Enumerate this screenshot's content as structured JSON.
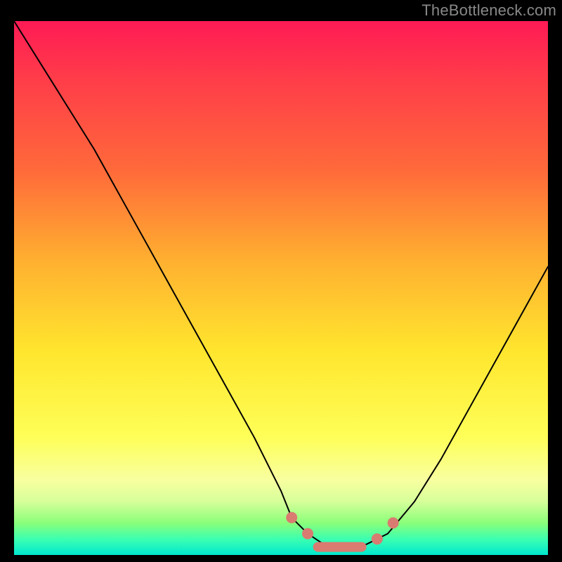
{
  "watermark": "TheBottleneck.com",
  "colors": {
    "background": "#000000",
    "curve": "#000000",
    "marker": "#d97b70"
  },
  "chart_data": {
    "type": "line",
    "title": "",
    "xlabel": "",
    "ylabel": "",
    "xlim": [
      0,
      100
    ],
    "ylim": [
      0,
      100
    ],
    "grid": false,
    "legend": false,
    "series": [
      {
        "name": "bottleneck-curve",
        "x": [
          0,
          5,
          10,
          15,
          20,
          25,
          30,
          35,
          40,
          45,
          50,
          52,
          55,
          58,
          62,
          66,
          70,
          75,
          80,
          85,
          90,
          95,
          100
        ],
        "y": [
          100,
          92,
          84,
          76,
          67,
          58,
          49,
          40,
          31,
          22,
          12,
          7,
          4,
          2,
          1,
          2,
          4,
          10,
          18,
          27,
          36,
          45,
          54
        ]
      }
    ],
    "markers": [
      {
        "name": "optimal-start",
        "x": 52,
        "y": 7
      },
      {
        "name": "optimal-mid-1",
        "x": 55,
        "y": 4
      },
      {
        "name": "optimal-pill",
        "x_start": 56,
        "x_end": 66,
        "y": 1.5
      },
      {
        "name": "optimal-mid-2",
        "x": 68,
        "y": 3
      },
      {
        "name": "optimal-end",
        "x": 71,
        "y": 6
      }
    ],
    "gradient_stops": [
      {
        "pos": 0.0,
        "color": "#ff1a55"
      },
      {
        "pos": 0.1,
        "color": "#ff3a4a"
      },
      {
        "pos": 0.28,
        "color": "#ff6a3a"
      },
      {
        "pos": 0.45,
        "color": "#ffb030"
      },
      {
        "pos": 0.62,
        "color": "#ffe62e"
      },
      {
        "pos": 0.78,
        "color": "#feff58"
      },
      {
        "pos": 0.86,
        "color": "#f8ffa0"
      },
      {
        "pos": 0.9,
        "color": "#d6ff9a"
      },
      {
        "pos": 0.94,
        "color": "#8aff7a"
      },
      {
        "pos": 0.97,
        "color": "#3cffb0"
      },
      {
        "pos": 1.0,
        "color": "#00e8d0"
      }
    ]
  }
}
